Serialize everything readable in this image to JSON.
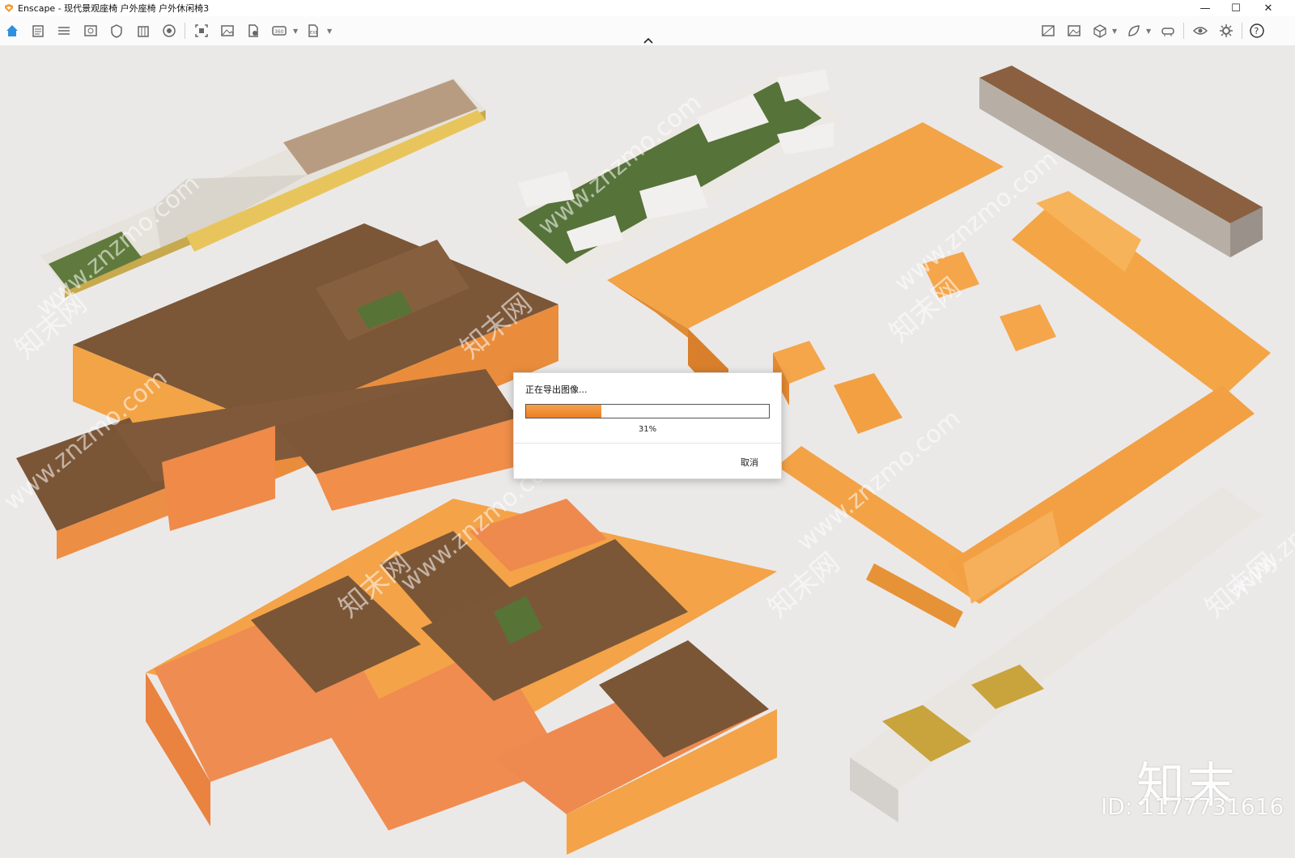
{
  "window": {
    "title": "Enscape - 现代景观座椅 户外座椅 户外休闲椅3",
    "controls": [
      "—",
      "☐",
      "✕"
    ]
  },
  "toolbar": {
    "left_icons": [
      "home-icon",
      "notes-icon",
      "bim-icon",
      "view-icon",
      "shield-icon",
      "building-icon",
      "atmosphere-icon",
      "screenshot-icon",
      "image-icon",
      "export-file-icon",
      "panorama-360-icon",
      "exe-export-icon"
    ],
    "right_icons": [
      "map-icon",
      "batch-render-icon",
      "cube-icon",
      "assets-icon",
      "headset-icon",
      "eye-icon",
      "settings-icon",
      "help-icon"
    ]
  },
  "dialog": {
    "title": "正在导出图像...",
    "progress": 31,
    "percent_label": "31%",
    "cancel_label": "取消"
  },
  "watermark": {
    "text": "www.znzmo.com",
    "cn_text": "知末网",
    "brand": "知末",
    "id_label": "ID: 1177731616"
  },
  "colors": {
    "accent": "#f0a24a",
    "orange": "#f59a3b",
    "wood": "#7a5535",
    "grass": "#5d7a3a"
  }
}
